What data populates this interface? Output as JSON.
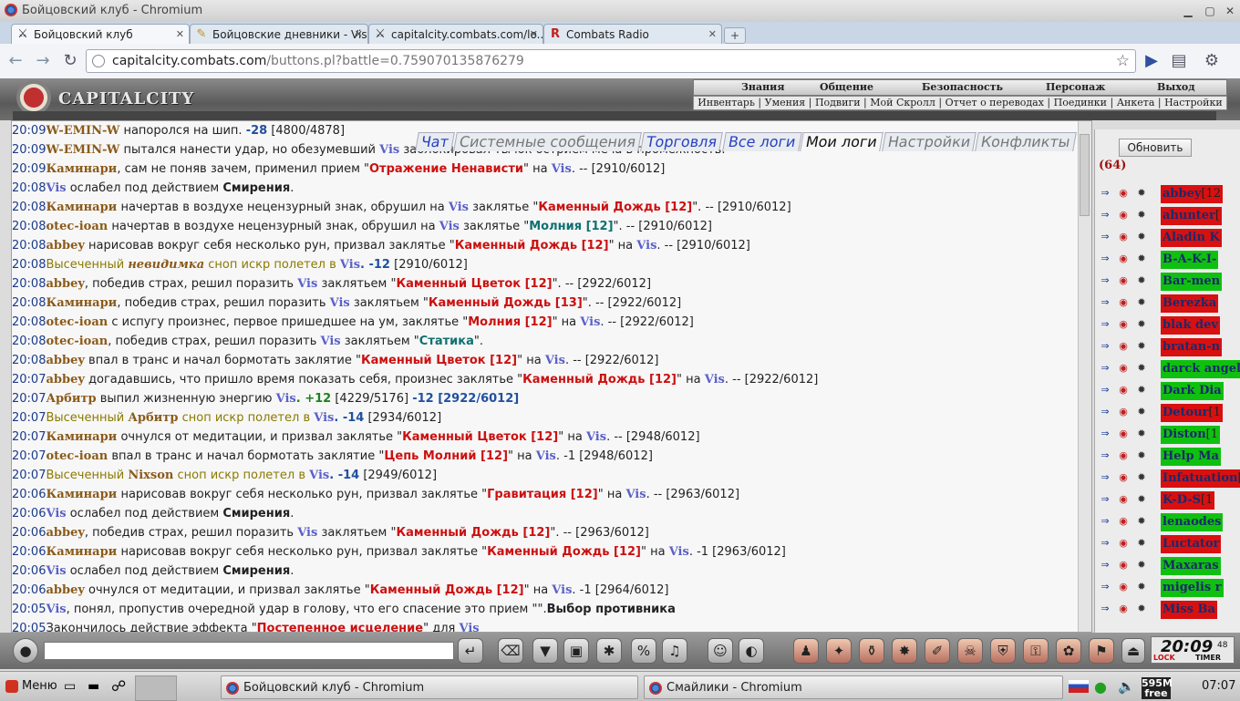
{
  "window": {
    "title": "Бойцовский клуб - Chromium"
  },
  "tabs": [
    {
      "label": "Бойцовский клуб",
      "active": true
    },
    {
      "label": "Бойцовские дневники - Vis",
      "active": false
    },
    {
      "label": "capitalcity.combats.com/lo...",
      "active": false
    },
    {
      "label": "Combats Radio",
      "active": false
    }
  ],
  "toolbar": {
    "url_host": "capitalcity.combats.com",
    "url_rest": "/buttons.pl?battle=0.759070135876279"
  },
  "game": {
    "logo": "CAPITALCITY",
    "menu": [
      "Знания",
      "Общение",
      "Безопасность",
      "Персонаж",
      "Выход"
    ],
    "submenu": "Инвентарь | Умения | Подвиги | Мой Скролл | Отчет о переводах | Поединки | Анкета | Настройки"
  },
  "logtabs": [
    {
      "label": "Чат"
    },
    {
      "label": "Системные сообщения"
    },
    {
      "label": "Торговля"
    },
    {
      "label": "Все логи"
    },
    {
      "label": "Мои логи"
    },
    {
      "label": "Настройки"
    },
    {
      "label": "Конфликты"
    }
  ],
  "log": [
    {
      "time": "20:09",
      "a": "W-EMIN-W",
      "text": " напоролся на шип. ",
      "d": "-28",
      "tail": " [4800/4878]"
    },
    {
      "time": "20:09",
      "a": "W-EMIN-W",
      "text": " пытался нанести удар, но обезумевший ",
      "b": "Vis",
      "tail": " заблокировал тычок острием меча в промежность."
    },
    {
      "time": "20:09",
      "a": "Каминари",
      "text": ", сам не поняв зачем, применил прием \"",
      "s": "Отражение Ненависти",
      "tail": "\" на ",
      "b": "Vis",
      "x": ". -- [2910/6012]"
    },
    {
      "time": "20:08",
      "b": "Vis",
      "text": " ослабел под действием ",
      "s": "Смирения",
      "tail": "."
    },
    {
      "time": "20:08",
      "a": "Каминари",
      "text": " начертав в воздухе нецензурный знак, обрушил на ",
      "b": "Vis",
      "tail": " заклятье \"",
      "s": "Каменный Дождь [12]",
      "x": "\". -- [2910/6012]"
    },
    {
      "time": "20:08",
      "a": "otec-ioan",
      "text": " начертав в воздухе нецензурный знак, обрушил на ",
      "b": "Vis",
      "tail": " заклятье \"",
      "s": "Молния [12]",
      "x": "\". -- [2910/6012]"
    },
    {
      "time": "20:08",
      "a": "abbey",
      "text": " нарисовав вокруг себя несколько рун, призвал заклятье \"",
      "s": "Каменный Дождь [12]",
      "tail": "\" на ",
      "b": "Vis",
      "x": ". -- [2910/6012]"
    },
    {
      "time": "20:08",
      "text": "Высеченный ",
      "a": "невидимка",
      "tail": " сноп искр полетел в ",
      "b": "Vis",
      "d": ". -12",
      "x": " [2910/6012]"
    },
    {
      "time": "20:08",
      "a": "abbey",
      "text": ", победив страх, решил поразить ",
      "b": "Vis",
      "tail": " заклятьем \"",
      "s": "Каменный Цветок [12]",
      "x": "\". -- [2922/6012]"
    },
    {
      "time": "20:08",
      "a": "Каминари",
      "text": ", победив страх, решил поразить ",
      "b": "Vis",
      "tail": " заклятьем \"",
      "s": "Каменный Дождь [13]",
      "x": "\". -- [2922/6012]"
    },
    {
      "time": "20:08",
      "a": "otec-ioan",
      "text": " с испугу произнес, первое пришедшее на ум, заклятье \"",
      "s": "Молния [12]",
      "tail": "\" на ",
      "b": "Vis",
      "x": ". -- [2922/6012]"
    },
    {
      "time": "20:08",
      "a": "otec-ioan",
      "text": ", победив страх, решил поразить ",
      "b": "Vis",
      "tail": " заклятьем \"",
      "s": "Статика",
      "x": "\"."
    },
    {
      "time": "20:08",
      "a": "abbey",
      "text": " впал в транс и начал бормотать заклятие \"",
      "s": "Каменный Цветок [12]",
      "tail": "\" на ",
      "b": "Vis",
      "x": ". -- [2922/6012]"
    },
    {
      "time": "20:07",
      "a": "abbey",
      "text": " догадавшись, что пришло время показать себя, произнес заклятье \"",
      "s": "Каменный Дождь [12]",
      "tail": "\" на ",
      "b": "Vis",
      "x": ". -- [2922/6012]"
    },
    {
      "time": "20:07",
      "a": "Арбитр",
      "text": " выпил жизненную энергию ",
      "b": "Vis",
      "d": ". +12",
      "tail": " [4229/5176] ",
      "x": "-12 [2922/6012]"
    },
    {
      "time": "20:07",
      "text": "Высеченный ",
      "a": "Арбитр",
      "tail": " сноп искр полетел в ",
      "b": "Vis",
      "d": ". -14",
      "x": " [2934/6012]"
    },
    {
      "time": "20:07",
      "a": "Каминари",
      "text": " очнулся от медитации, и призвал заклятье \"",
      "s": "Каменный Цветок [12]",
      "tail": "\" на ",
      "b": "Vis",
      "x": ". -- [2948/6012]"
    },
    {
      "time": "20:07",
      "a": "otec-ioan",
      "text": " впал в транс и начал бормотать заклятие \"",
      "s": "Цепь Молний [12]",
      "tail": "\" на ",
      "b": "Vis",
      "x": ". -1 [2948/6012]"
    },
    {
      "time": "20:07",
      "text": "Высеченный ",
      "a": "Nixson",
      "tail": " сноп искр полетел в ",
      "b": "Vis",
      "d": ". -14",
      "x": " [2949/6012]"
    },
    {
      "time": "20:06",
      "a": "Каминари",
      "text": " нарисовав вокруг себя несколько рун, призвал заклятье \"",
      "s": "Гравитация [12]",
      "tail": "\" на ",
      "b": "Vis",
      "x": ". -- [2963/6012]"
    },
    {
      "time": "20:06",
      "b": "Vis",
      "text": " ослабел под действием ",
      "s": "Смирения",
      "tail": "."
    },
    {
      "time": "20:06",
      "a": "abbey",
      "text": ", победив страх, решил поразить ",
      "b": "Vis",
      "tail": " заклятьем \"",
      "s": "Каменный Дождь [12]",
      "x": "\". -- [2963/6012]"
    },
    {
      "time": "20:06",
      "a": "Каминари",
      "text": " нарисовав вокруг себя несколько рун, призвал заклятье \"",
      "s": "Каменный Дождь [12]",
      "tail": "\" на ",
      "b": "Vis",
      "x": ". -1 [2963/6012]"
    },
    {
      "time": "20:06",
      "b": "Vis",
      "text": " ослабел под действием ",
      "s": "Смирения",
      "tail": "."
    },
    {
      "time": "20:06",
      "a": "abbey",
      "text": " очнулся от медитации, и призвал заклятье \"",
      "s": "Каменный Дождь [12]",
      "tail": "\" на ",
      "b": "Vis",
      "x": ". -1 [2964/6012]"
    },
    {
      "time": "20:05",
      "b": "Vis",
      "text": ", понял, пропустив очередной удар в голову, что его спасение это прием \"",
      "s": "Выбор противника",
      "tail": "\"."
    },
    {
      "time": "20:05",
      "text": "Закончилось действие эффекта \"",
      "s": "Постепенное исцеление",
      "tail": "\" для ",
      "b": "Vis"
    }
  ],
  "rightpanel": {
    "refresh_label": "Обновить",
    "count": "(64)",
    "players": [
      {
        "name": "abbey",
        "suffix": "[12",
        "color": "red"
      },
      {
        "name": "ahunter",
        "suffix": "[",
        "color": "red"
      },
      {
        "name": "Aladin K",
        "suffix": "",
        "color": "red"
      },
      {
        "name": "B-A-K-I-",
        "suffix": "",
        "color": "green"
      },
      {
        "name": "Bar-men",
        "suffix": "",
        "color": "green"
      },
      {
        "name": "Berezka",
        "suffix": "",
        "color": "red"
      },
      {
        "name": "blak dev",
        "suffix": "",
        "color": "red"
      },
      {
        "name": "bratan-n",
        "suffix": "",
        "color": "red"
      },
      {
        "name": "darck angel",
        "suffix": "[",
        "color": "green"
      },
      {
        "name": "Dark Dia",
        "suffix": "",
        "color": "green"
      },
      {
        "name": "Detour",
        "suffix": "[1",
        "color": "red"
      },
      {
        "name": "Diston",
        "suffix": "[1",
        "color": "green"
      },
      {
        "name": "Help Ma",
        "suffix": "",
        "color": "green"
      },
      {
        "name": "Infatuation",
        "suffix": "[1",
        "color": "red"
      },
      {
        "name": "K-D-S",
        "suffix": "[1",
        "color": "red"
      },
      {
        "name": "lenaodes",
        "suffix": "",
        "color": "green"
      },
      {
        "name": "Luctator",
        "suffix": "",
        "color": "red"
      },
      {
        "name": "Maxaras",
        "suffix": "",
        "color": "green"
      },
      {
        "name": "migelis r",
        "suffix": "",
        "color": "green"
      },
      {
        "name": "Miss Ba",
        "suffix": "",
        "color": "red"
      }
    ]
  },
  "clock": {
    "time": "20:09",
    "sec": "48",
    "lock": "LOCK",
    "timer": "TIMER"
  },
  "taskbar": {
    "start": "Меню",
    "tasks": [
      "Бойцовский клуб - Chromium",
      "Смайлики - Chromium"
    ],
    "memory": "595M free",
    "time": "07:07"
  }
}
